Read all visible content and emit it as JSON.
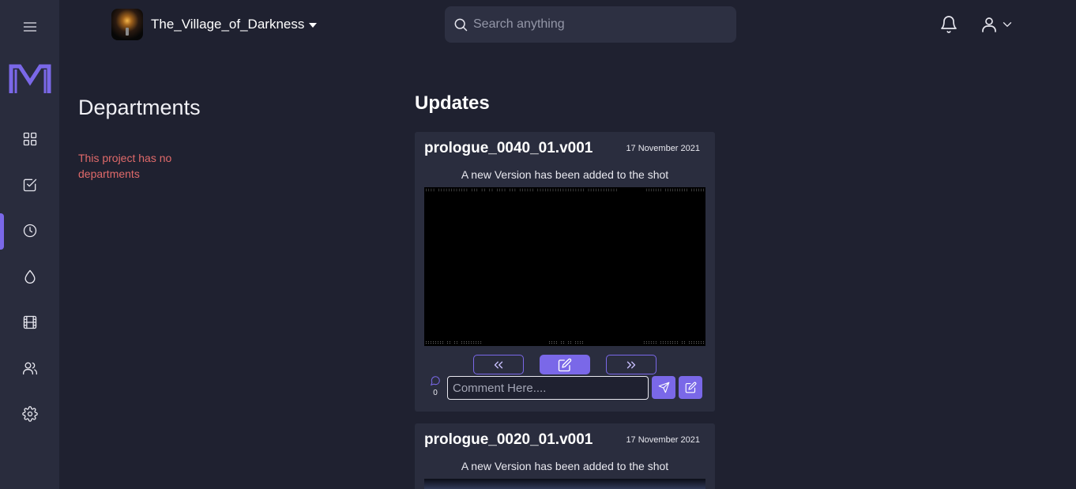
{
  "app": {
    "logo": "mi-logo",
    "accent": "#7a68e8"
  },
  "sidebar": {
    "items": [
      {
        "name": "menu",
        "icon": "hamburger-icon",
        "active": false
      },
      {
        "name": "dashboard",
        "icon": "grid-icon",
        "active": false
      },
      {
        "name": "tasks",
        "icon": "checkbox-icon",
        "active": false
      },
      {
        "name": "updates",
        "icon": "clock-icon",
        "active": true
      },
      {
        "name": "assets",
        "icon": "drop-icon",
        "active": false
      },
      {
        "name": "shots",
        "icon": "film-icon",
        "active": false
      },
      {
        "name": "team",
        "icon": "users-icon",
        "active": false
      },
      {
        "name": "settings",
        "icon": "gear-icon",
        "active": false
      }
    ]
  },
  "header": {
    "project_name": "The_Village_of_Darkness",
    "search_placeholder": "Search anything",
    "notification_icon": "bell-icon",
    "user_icon": "user-icon"
  },
  "departments": {
    "title": "Departments",
    "empty_message": "This project has no departments",
    "error_color": "#e06a6a"
  },
  "updates": {
    "title": "Updates",
    "cards": [
      {
        "title": "prologue_0040_01.v001",
        "date": "17 November 2021",
        "message": "A new Version has been added to the shot",
        "comment_count": "0",
        "comment_placeholder": "Comment Here...."
      },
      {
        "title": "prologue_0020_01.v001",
        "date": "17 November 2021",
        "message": "A new Version has been added to the shot"
      }
    ]
  }
}
